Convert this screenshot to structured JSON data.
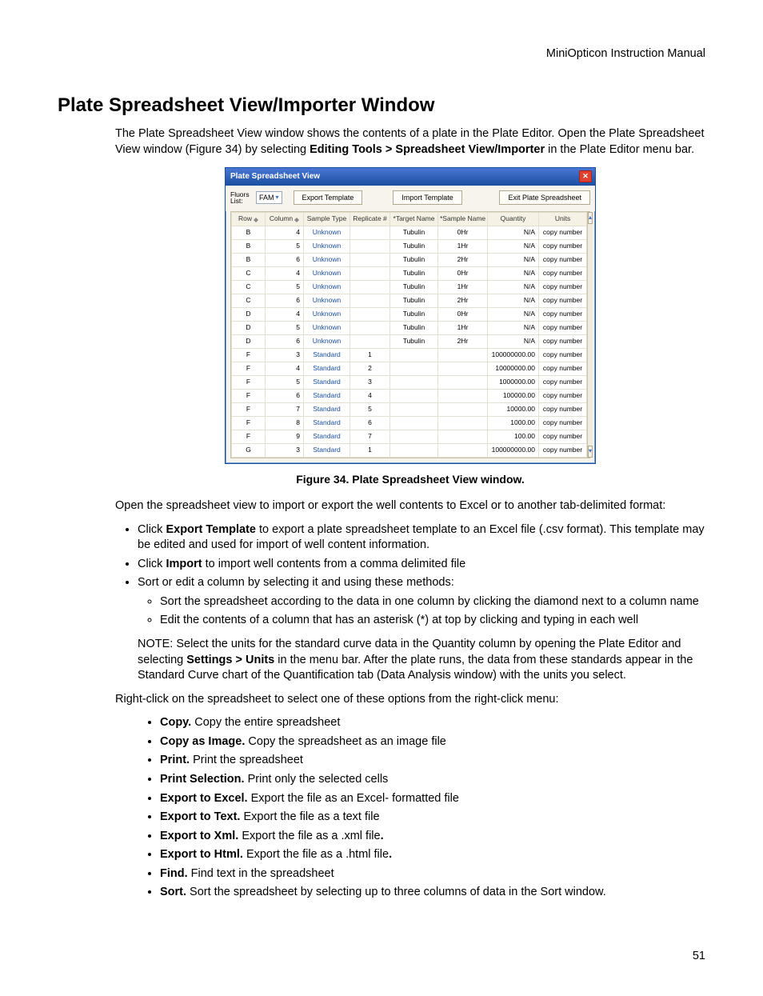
{
  "runningHead": "MiniOpticon Instruction Manual",
  "pageNumber": "51",
  "heading": "Plate Spreadsheet View/Importer Window",
  "intro": {
    "part1": "The Plate Spreadsheet View window shows the contents of a plate in the Plate Editor. Open the Plate Spreadsheet View window (Figure 34) by selecting ",
    "bold1": "Editing Tools > Spreadsheet View/Importer",
    "part2": " in the Plate Editor menu bar."
  },
  "figureCaption": "Figure 34. Plate Spreadsheet View window.",
  "afterFigPara": "Open the spreadsheet view to import or export the well contents to Excel or to another tab-delimited format:",
  "mainBullets": {
    "b1_pre": "Click ",
    "b1_bold": "Export Template",
    "b1_post": " to export a plate spreadsheet template to an Excel file (.csv format). This template may be edited and used for import of well content information.",
    "b2_pre": "Click ",
    "b2_bold": "Import",
    "b2_post": " to import well contents from a comma delimited file",
    "b3": "Sort or edit a column by selecting it and using these methods:",
    "b3_sub1": "Sort the spreadsheet according to the data in one column by clicking the diamond next to a column name",
    "b3_sub2": "Edit the contents of a column that has an asterisk (*) at top by clicking and typing in each well"
  },
  "note": {
    "pre": "NOTE: Select the units for the standard curve data in the Quantity column by opening the Plate Editor and selecting ",
    "bold": "Settings > Units",
    "post": " in the menu bar. After the plate runs, the data from these standards appear in the Standard Curve chart of the Quantification tab (Data Analysis window) with the units you select."
  },
  "rcIntro": "Right-click on the spreadsheet to select one of these options from the right-click menu:",
  "rcItems": [
    {
      "bold": "Copy.",
      "rest": " Copy the entire spreadsheet"
    },
    {
      "bold": "Copy as Image.",
      "rest": " Copy the spreadsheet as an image file"
    },
    {
      "bold": "Print.",
      "rest": " Print the spreadsheet"
    },
    {
      "bold": "Print Selection.",
      "rest": " Print only the selected cells"
    },
    {
      "bold": "Export to Excel.",
      "rest": " Export the file as an Excel- formatted file"
    },
    {
      "bold": "Export to Text.",
      "rest": " Export the file as a text file"
    },
    {
      "bold": "Export to Xml.",
      "rest": " Export the file as a .xml file",
      "trailingBoldDot": "."
    },
    {
      "bold": "Export to Html.",
      "rest": " Export the file as a .html file",
      "trailingBoldDot": "."
    },
    {
      "bold": "Find.",
      "rest": " Find text in the spreadsheet"
    },
    {
      "bold": "Sort.",
      "rest": " Sort the spreadsheet by selecting up to three columns of data in the Sort window."
    }
  ],
  "win": {
    "title": "Plate Spreadsheet View",
    "fluorsLabel": "Fluors List:",
    "fluorValue": "FAM",
    "btnExport": "Export Template",
    "btnImport": "Import Template",
    "btnExit": "Exit Plate Spreadsheet",
    "headers": [
      "Row",
      "Column",
      "Sample Type",
      "Replicate #",
      "*Target Name",
      "*Sample Name",
      "Quantity",
      "Units"
    ],
    "rows": [
      {
        "row": "B",
        "col": "4",
        "type": "Unknown",
        "rep": "",
        "target": "Tubulin",
        "sample": "0Hr",
        "qty": "N/A",
        "units": "copy number"
      },
      {
        "row": "B",
        "col": "5",
        "type": "Unknown",
        "rep": "",
        "target": "Tubulin",
        "sample": "1Hr",
        "qty": "N/A",
        "units": "copy number"
      },
      {
        "row": "B",
        "col": "6",
        "type": "Unknown",
        "rep": "",
        "target": "Tubulin",
        "sample": "2Hr",
        "qty": "N/A",
        "units": "copy number"
      },
      {
        "row": "C",
        "col": "4",
        "type": "Unknown",
        "rep": "",
        "target": "Tubulin",
        "sample": "0Hr",
        "qty": "N/A",
        "units": "copy number"
      },
      {
        "row": "C",
        "col": "5",
        "type": "Unknown",
        "rep": "",
        "target": "Tubulin",
        "sample": "1Hr",
        "qty": "N/A",
        "units": "copy number"
      },
      {
        "row": "C",
        "col": "6",
        "type": "Unknown",
        "rep": "",
        "target": "Tubulin",
        "sample": "2Hr",
        "qty": "N/A",
        "units": "copy number"
      },
      {
        "row": "D",
        "col": "4",
        "type": "Unknown",
        "rep": "",
        "target": "Tubulin",
        "sample": "0Hr",
        "qty": "N/A",
        "units": "copy number"
      },
      {
        "row": "D",
        "col": "5",
        "type": "Unknown",
        "rep": "",
        "target": "Tubulin",
        "sample": "1Hr",
        "qty": "N/A",
        "units": "copy number"
      },
      {
        "row": "D",
        "col": "6",
        "type": "Unknown",
        "rep": "",
        "target": "Tubulin",
        "sample": "2Hr",
        "qty": "N/A",
        "units": "copy number"
      },
      {
        "row": "F",
        "col": "3",
        "type": "Standard",
        "rep": "1",
        "target": "",
        "sample": "",
        "qty": "100000000.00",
        "units": "copy number"
      },
      {
        "row": "F",
        "col": "4",
        "type": "Standard",
        "rep": "2",
        "target": "",
        "sample": "",
        "qty": "10000000.00",
        "units": "copy number"
      },
      {
        "row": "F",
        "col": "5",
        "type": "Standard",
        "rep": "3",
        "target": "",
        "sample": "",
        "qty": "1000000.00",
        "units": "copy number"
      },
      {
        "row": "F",
        "col": "6",
        "type": "Standard",
        "rep": "4",
        "target": "",
        "sample": "",
        "qty": "100000.00",
        "units": "copy number"
      },
      {
        "row": "F",
        "col": "7",
        "type": "Standard",
        "rep": "5",
        "target": "",
        "sample": "",
        "qty": "10000.00",
        "units": "copy number"
      },
      {
        "row": "F",
        "col": "8",
        "type": "Standard",
        "rep": "6",
        "target": "",
        "sample": "",
        "qty": "1000.00",
        "units": "copy number"
      },
      {
        "row": "F",
        "col": "9",
        "type": "Standard",
        "rep": "7",
        "target": "",
        "sample": "",
        "qty": "100.00",
        "units": "copy number"
      },
      {
        "row": "G",
        "col": "3",
        "type": "Standard",
        "rep": "1",
        "target": "",
        "sample": "",
        "qty": "100000000.00",
        "units": "copy number"
      }
    ]
  }
}
